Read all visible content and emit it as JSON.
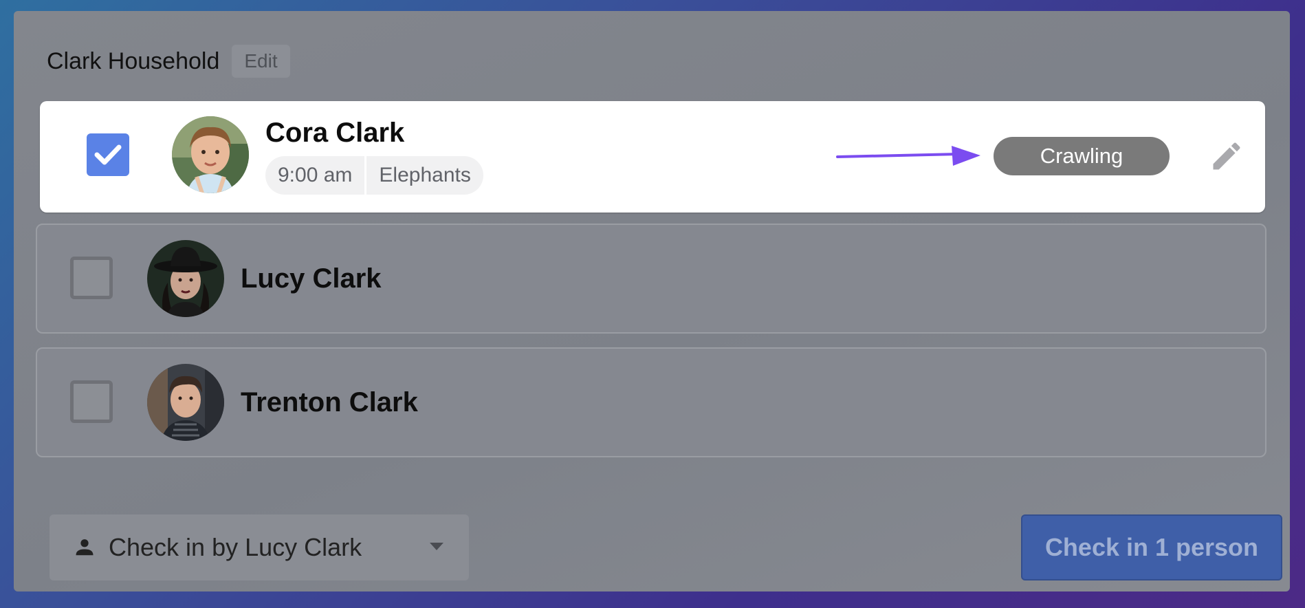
{
  "household": {
    "title": "Clark Household",
    "edit_label": "Edit"
  },
  "people": [
    {
      "name": "Cora Clark",
      "checked": true,
      "time": "9:00 am",
      "room": "Elephants",
      "status": "Crawling"
    },
    {
      "name": "Lucy Clark",
      "checked": false
    },
    {
      "name": "Trenton Clark",
      "checked": false
    }
  ],
  "footer": {
    "checkin_by_label": "Check in by Lucy Clark",
    "checkin_button_label": "Check in 1 person"
  },
  "colors": {
    "accent": "#5a82e6",
    "arrow": "#7b4cf0",
    "status_pill": "#7a7a7a",
    "primary_button": "#3f5fa8"
  },
  "icons": [
    "check-icon",
    "arrow-right-icon",
    "pencil-icon",
    "person-icon",
    "caret-down-icon"
  ]
}
